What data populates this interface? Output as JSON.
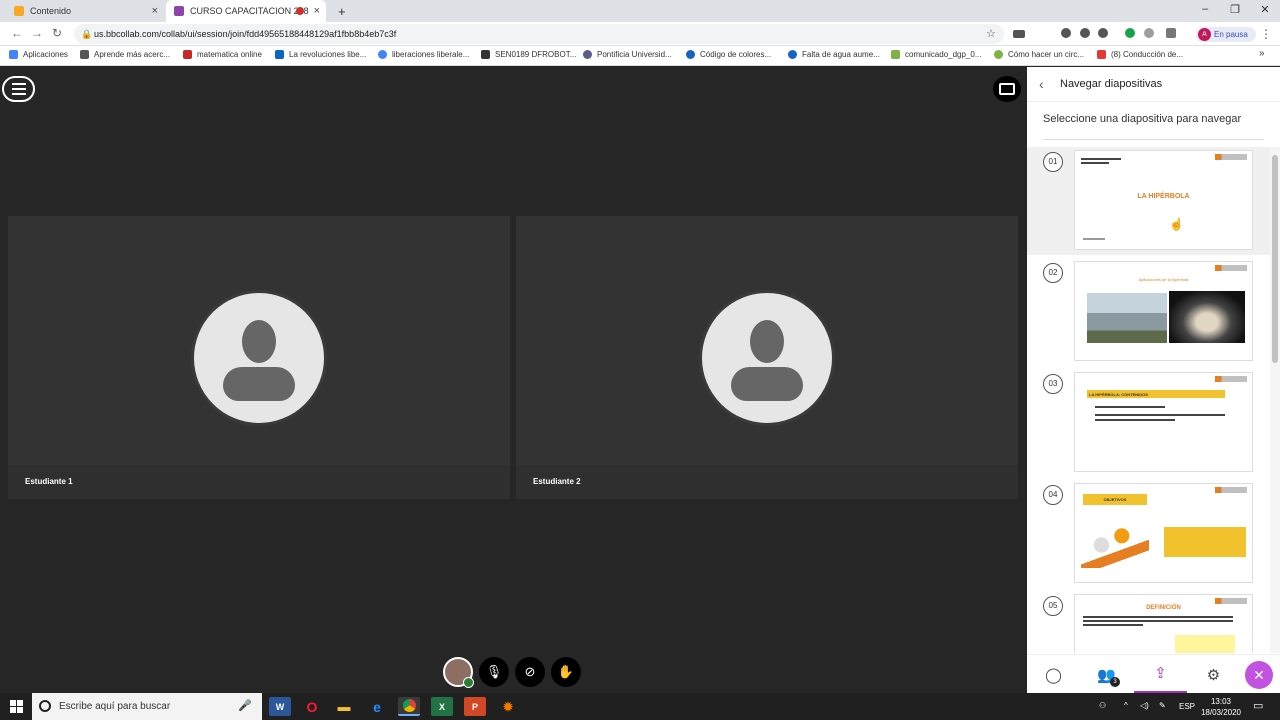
{
  "browser": {
    "tabs": [
      {
        "title": "Contenido",
        "color": "#f9a825"
      },
      {
        "title": "CURSO CAPACITACION 288",
        "color": "#8e44ad"
      }
    ],
    "new_tab": "+",
    "url": "us.bbcollab.com/collab/ui/session/join/fdd49565188448129af1fbb8b4eb7c3f",
    "profile_initial": "A",
    "profile_status": "En pausa",
    "bookmarks": [
      {
        "label": "Aplicaciones",
        "color": "#4285f4"
      },
      {
        "label": "Aprende más acerc...",
        "color": "#555555"
      },
      {
        "label": "matematica online",
        "color": "#c62828"
      },
      {
        "label": "La revoluciones libe...",
        "color": "#0a66c2"
      },
      {
        "label": "liberaciones liberale...",
        "color": "#4285f4"
      },
      {
        "label": "SEN0189 DFROBOT...",
        "color": "#333333"
      },
      {
        "label": "Pontificia Universid...",
        "color": "#5c5c8a"
      },
      {
        "label": "Código de colores...",
        "color": "#1565c0"
      },
      {
        "label": "Falta de agua aume...",
        "color": "#1565c0"
      },
      {
        "label": "comunicado_dgp_0...",
        "color": "#7cb342"
      },
      {
        "label": "Cómo hacer un circ...",
        "color": "#7cb342"
      },
      {
        "label": "(8) Conducción de...",
        "color": "#e53935"
      }
    ],
    "more_bookmarks": "»"
  },
  "stage": {
    "participants": [
      {
        "name": "Estudiante 1"
      },
      {
        "name": "Estudiante 2"
      }
    ]
  },
  "panel": {
    "title": "Navegar diapositivas",
    "subtitle": "Seleccione una diapositiva para navegar",
    "slides": [
      {
        "num": "01",
        "title": "LA HIPÉRBOLA"
      },
      {
        "num": "02",
        "title": "Aplicaciones de la hipérbola"
      },
      {
        "num": "03",
        "title": "LA HIPÉRBOLA: CONTENIDOS"
      },
      {
        "num": "04",
        "title": "OBJETIVOS"
      },
      {
        "num": "05",
        "title": "DEFINICIÓN"
      }
    ],
    "participants_count": "3",
    "accent": "#a233c2"
  },
  "taskbar": {
    "search_placeholder": "Escribe aquí para buscar",
    "language": "ESP",
    "time": "13:03",
    "date": "18/03/2020"
  }
}
